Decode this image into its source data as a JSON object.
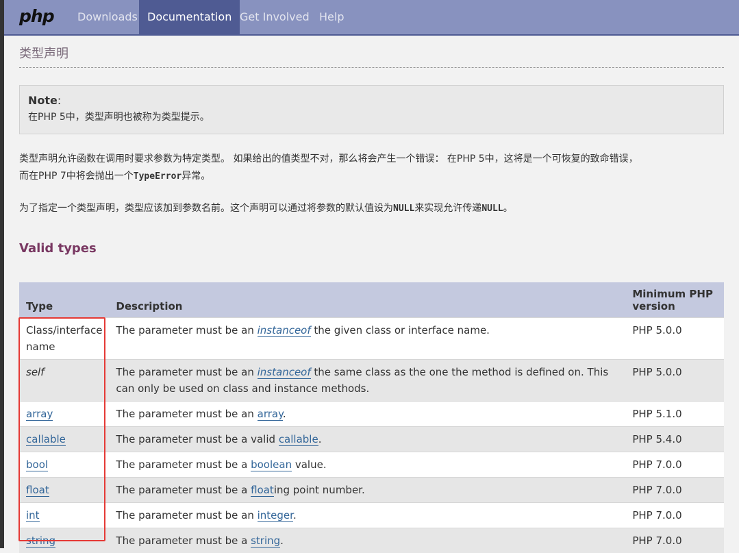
{
  "nav": {
    "logo": "php",
    "items": [
      {
        "label": "Downloads",
        "active": false
      },
      {
        "label": "Documentation",
        "active": true
      },
      {
        "label": "Get Involved",
        "active": false
      },
      {
        "label": "Help",
        "active": false
      }
    ]
  },
  "page": {
    "title": "类型声明",
    "note": {
      "title": "Note",
      "colon": ":",
      "text": "在PHP 5中，类型声明也被称为类型提示。"
    },
    "para1": {
      "line1": "类型声明允许函数在调用时要求参数为特定类型。 如果给出的值类型不对，那么将会产生一个错误： 在PHP 5中，这将是一个可恢复的致命错误，",
      "line2_before": "而在PHP 7中将会抛出一个",
      "line2_code": "TypeError",
      "line2_after": "异常。"
    },
    "para2": {
      "before": "为了指定一个类型声明，类型应该加到参数名前。这个声明可以通过将参数的默认值设为",
      "code1": "NULL",
      "middle": "来实现允许传递",
      "code2": "NULL",
      "after": "。"
    },
    "section_title": "Valid types",
    "table": {
      "headers": {
        "type": "Type",
        "description": "Description",
        "version_line1": "Minimum PHP",
        "version_line2": "version"
      },
      "rows": [
        {
          "type": "Class/interface name",
          "desc_before": "The parameter must be an ",
          "desc_link": "instanceof",
          "desc_after": " the given class or interface name.",
          "version": "PHP 5.0.0"
        },
        {
          "type": "self",
          "desc_before": "The parameter must be an ",
          "desc_link": "instanceof",
          "desc_after": " the same class as the one the method is defined on. This can only be used on class and instance methods.",
          "version": "PHP 5.0.0"
        },
        {
          "type": "array",
          "desc_before": "The parameter must be an ",
          "desc_link": "array",
          "desc_after": ".",
          "version": "PHP 5.1.0"
        },
        {
          "type": "callable",
          "desc_before": "The parameter must be a valid ",
          "desc_link": "callable",
          "desc_after": ".",
          "version": "PHP 5.4.0"
        },
        {
          "type": "bool",
          "desc_before": "The parameter must be a ",
          "desc_link": "boolean",
          "desc_after": " value.",
          "version": "PHP 7.0.0"
        },
        {
          "type": "float",
          "desc_before": "The parameter must be a ",
          "desc_link": "float",
          "desc_after": "ing point number.",
          "version": "PHP 7.0.0"
        },
        {
          "type": "int",
          "desc_before": "The parameter must be an ",
          "desc_link": "integer",
          "desc_after": ".",
          "version": "PHP 7.0.0"
        },
        {
          "type": "string",
          "desc_before": "The parameter must be a ",
          "desc_link": "string",
          "desc_after": ".",
          "version": "PHP 7.0.0"
        }
      ]
    }
  },
  "colors": {
    "nav_bg": "#8892bf",
    "nav_active": "#4f5b93",
    "link": "#336699",
    "section_title": "#793862",
    "highlight_box": "#e53935"
  }
}
